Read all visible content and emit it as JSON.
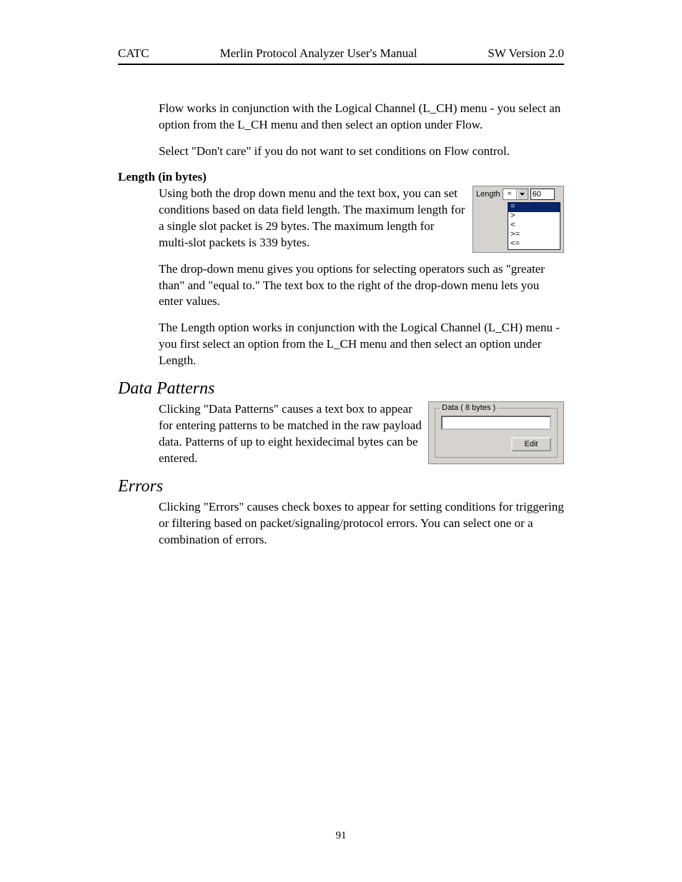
{
  "header": {
    "left": "CATC",
    "center": "Merlin Protocol Analyzer User's Manual",
    "right": "SW Version 2.0"
  },
  "intro": {
    "p1": "Flow works in conjunction with the Logical Channel (L_CH) menu - you select an option from the L_CH menu and then select an option under Flow.",
    "p2": "Select \"Don't care\" if you do not want to set conditions on Flow control."
  },
  "length_section": {
    "heading": "Length (in bytes)",
    "p1": "Using both the drop down menu and the text box, you can set conditions based on data field length.  The maximum length for a single slot packet is 29 bytes.  The maximum length for multi-slot packets is 339 bytes.",
    "p2": "The drop-down menu gives you options for selecting operators such as \"greater than\" and \"equal to.\"  The text box to the right of the drop-down menu lets you enter values.",
    "p3": "The Length option works in conjunction with the Logical Channel (L_CH) menu - you first select an option from the L_CH menu and then select an option under Length."
  },
  "length_widget": {
    "label": "Length",
    "selected_operator": "=",
    "value": "60",
    "options": [
      "=",
      ">",
      "<",
      ">=",
      "<="
    ]
  },
  "data_section": {
    "heading": "Data Patterns",
    "p1": "Clicking \"Data Patterns\" causes a text box to appear for entering patterns to be matched in the raw payload data.  Patterns of up to eight hexidecimal bytes can be entered."
  },
  "data_widget": {
    "group_label": "Data ( 8 bytes )",
    "input_value": "",
    "button_label": "Edit"
  },
  "errors_section": {
    "heading": "Errors",
    "p1": "Clicking \"Errors\" causes check boxes to appear for setting conditions for triggering or filtering based on packet/signaling/protocol errors.  You can select one or a combination of errors."
  },
  "page_number": "91"
}
